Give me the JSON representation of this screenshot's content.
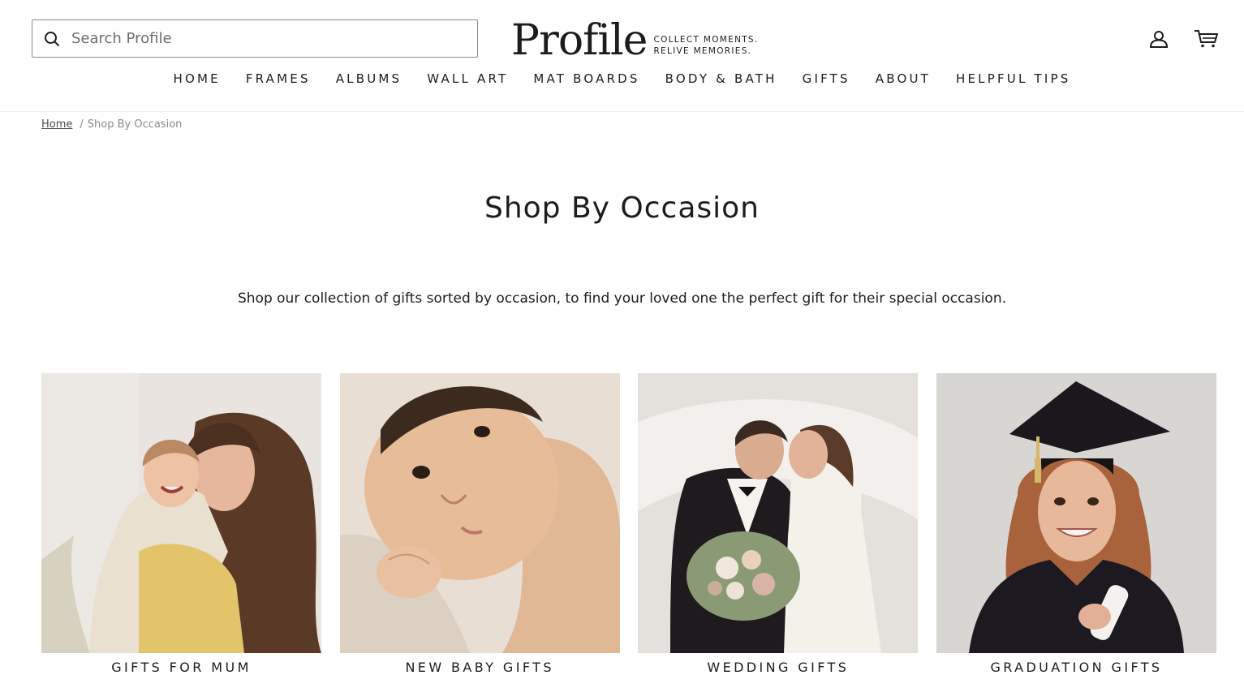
{
  "header": {
    "search": {
      "placeholder": "Search Profile",
      "value": ""
    },
    "logo": {
      "word": "Profile",
      "tagline_line1": "COLLECT MOMENTS.",
      "tagline_line2": "RELIVE MEMORIES."
    },
    "account_icon": "user-icon",
    "cart_icon": "cart-icon",
    "nav": [
      "HOME",
      "FRAMES",
      "ALBUMS",
      "WALL ART",
      "MAT BOARDS",
      "BODY & BATH",
      "GIFTS",
      "ABOUT",
      "HELPFUL TIPS"
    ]
  },
  "breadcrumb": {
    "home": "Home",
    "separator": "/",
    "current": "Shop By Occasion"
  },
  "page": {
    "title": "Shop By Occasion",
    "description": "Shop our collection of gifts sorted by occasion, to find your loved one the perfect gift for their special occasion."
  },
  "collections": [
    {
      "label": "GIFTS FOR MUM"
    },
    {
      "label": "NEW BABY GIFTS"
    },
    {
      "label": "WEDDING GIFTS"
    },
    {
      "label": "GRADUATION GIFTS"
    }
  ],
  "colors": {
    "text": "#1c1c1c",
    "muted": "#8a8a8a",
    "border": "#8a8a8a",
    "background": "#ffffff"
  }
}
